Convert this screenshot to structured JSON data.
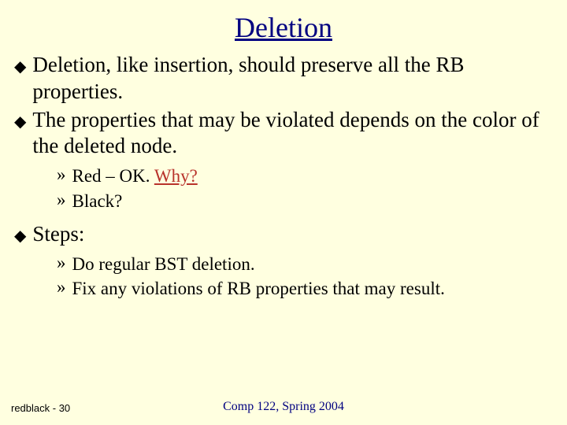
{
  "title": "Deletion",
  "bullets": [
    {
      "text": "Deletion, like insertion, should preserve all the RB properties.",
      "subs": []
    },
    {
      "text": "The properties that may be violated depends on the color of the deleted node.",
      "subs": [
        {
          "prefix": "Red – OK. ",
          "link": "Why?",
          "suffix": ""
        },
        {
          "prefix": "Black?",
          "link": "",
          "suffix": ""
        }
      ]
    },
    {
      "text": "Steps:",
      "subs": [
        {
          "prefix": "Do regular BST deletion.",
          "link": "",
          "suffix": ""
        },
        {
          "prefix": "Fix any violations of RB properties that may result.",
          "link": "",
          "suffix": ""
        }
      ]
    }
  ],
  "footer": {
    "left": "redblack - 30",
    "center": "Comp 122, Spring 2004"
  }
}
